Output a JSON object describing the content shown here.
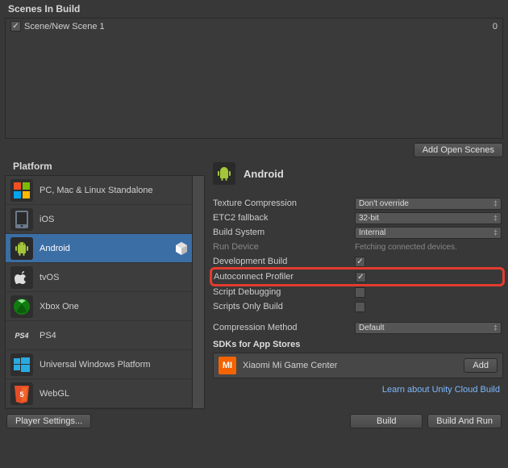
{
  "scenesInBuild": {
    "title": "Scenes In Build",
    "items": [
      {
        "name": "Scene/New Scene 1",
        "checked": true,
        "index": "0"
      }
    ],
    "addOpenScenes": "Add Open Scenes"
  },
  "platform": {
    "title": "Platform",
    "items": [
      {
        "id": "standalone",
        "label": "PC, Mac & Linux Standalone"
      },
      {
        "id": "ios",
        "label": "iOS"
      },
      {
        "id": "android",
        "label": "Android",
        "selected": true,
        "unityBadge": true
      },
      {
        "id": "tvos",
        "label": "tvOS"
      },
      {
        "id": "xboxone",
        "label": "Xbox One"
      },
      {
        "id": "ps4",
        "label": "PS4"
      },
      {
        "id": "uwp",
        "label": "Universal Windows Platform"
      },
      {
        "id": "webgl",
        "label": "WebGL"
      }
    ]
  },
  "settings": {
    "headerTitle": "Android",
    "textureCompression": {
      "label": "Texture Compression",
      "value": "Don't override"
    },
    "etc2Fallback": {
      "label": "ETC2 fallback",
      "value": "32-bit"
    },
    "buildSystem": {
      "label": "Build System",
      "value": "Internal"
    },
    "runDevice": {
      "label": "Run Device",
      "value": "Fetching connected devices."
    },
    "developmentBuild": {
      "label": "Development Build",
      "checked": true
    },
    "autoconnectProfiler": {
      "label": "Autoconnect Profiler",
      "checked": true
    },
    "scriptDebugging": {
      "label": "Script Debugging",
      "checked": false
    },
    "scriptsOnlyBuild": {
      "label": "Scripts Only Build",
      "checked": false
    },
    "compressionMethod": {
      "label": "Compression Method",
      "value": "Default"
    },
    "sdkSectionTitle": "SDKs for App Stores",
    "sdk": {
      "iconText": "MI",
      "label": "Xiaomi Mi Game Center",
      "addLabel": "Add"
    },
    "cloudBuildLink": "Learn about Unity Cloud Build"
  },
  "bottom": {
    "playerSettings": "Player Settings...",
    "build": "Build",
    "buildAndRun": "Build And Run"
  }
}
